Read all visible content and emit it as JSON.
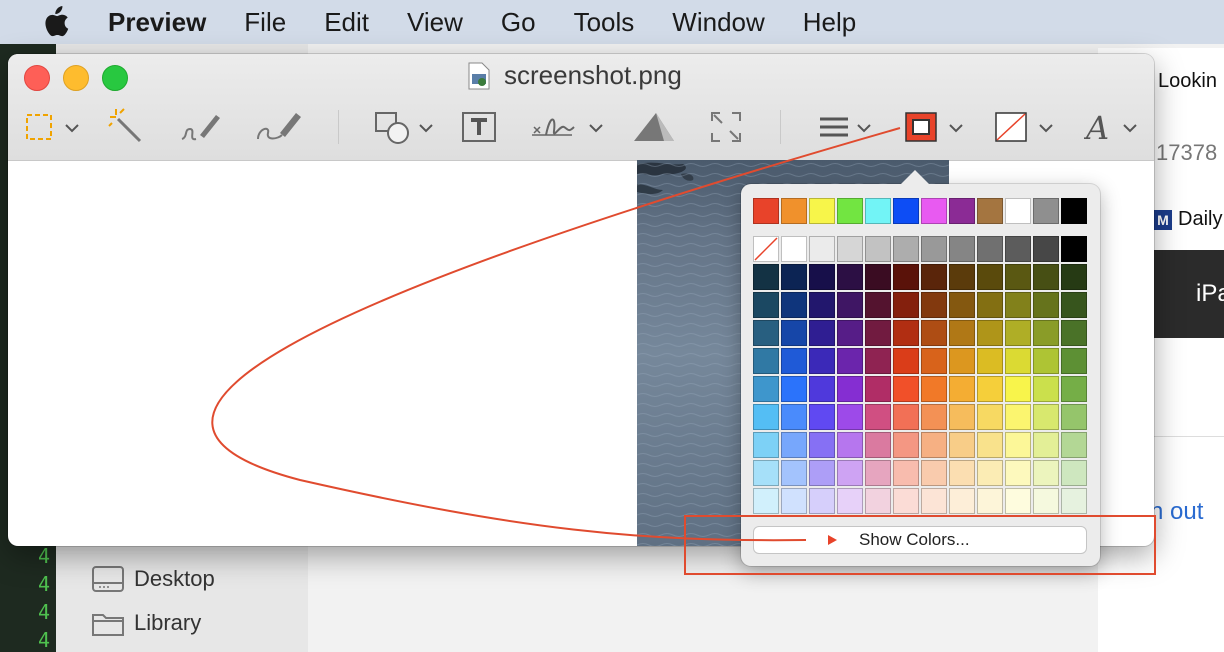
{
  "menubar": {
    "app_name": "Preview",
    "items": [
      "File",
      "Edit",
      "View",
      "Go",
      "Tools",
      "Window",
      "Help"
    ]
  },
  "window": {
    "title": "screenshot.png",
    "toolbar": {
      "icons": [
        "rectangular-selection-icon",
        "instant-alpha-icon",
        "sketch-icon",
        "draw-icon",
        "shapes-icon",
        "text-icon",
        "sign-icon",
        "adjust-color-icon",
        "adjust-size-icon",
        "shape-style-icon",
        "border-color-icon",
        "fill-color-icon",
        "text-style-icon"
      ]
    }
  },
  "background": {
    "finder_items": [
      "Desktop",
      "Library"
    ],
    "terminal_numbers": [
      "4",
      "4",
      "4",
      "4"
    ],
    "browser": {
      "title_snippet": "Lookin",
      "number_snippet": "17378",
      "news_snippet": "Daily",
      "news_logo": "M",
      "banner_snippet": "iPa",
      "link_snippet": "n out"
    }
  },
  "color_popover": {
    "show_colors_label": "Show Colors...",
    "top_row": [
      "#e8432a",
      "#f0912c",
      "#f7f54a",
      "#72e541",
      "#72f4f6",
      "#0d4df5",
      "#e85af1",
      "#8b2b95",
      "#a47540",
      "#ffffff",
      "#8f8f8f",
      "#000000"
    ],
    "gray_row": [
      "none",
      "#ffffff",
      "#ebebeb",
      "#d6d6d6",
      "#c2c2c2",
      "#adadad",
      "#999999",
      "#858585",
      "#707070",
      "#5c5c5c",
      "#474747",
      "#000000"
    ],
    "grid": [
      [
        "#133244",
        "#0c2454",
        "#170f4a",
        "#2c0f44",
        "#3a0c22",
        "#5a1209",
        "#5a250a",
        "#5b3b0b",
        "#5a4a0c",
        "#5a5812",
        "#474f14",
        "#263a14"
      ],
      [
        "#1b4862",
        "#0f357c",
        "#22176d",
        "#3f1664",
        "#54132f",
        "#84200d",
        "#82390e",
        "#845810",
        "#836f12",
        "#82811b",
        "#66731c",
        "#37551d"
      ],
      [
        "#285f80",
        "#1646a8",
        "#2f1e92",
        "#561d87",
        "#711b40",
        "#b12e12",
        "#ae4d14",
        "#b07816",
        "#af9519",
        "#afae26",
        "#8a9c28",
        "#4a7228"
      ],
      [
        "#3079a4",
        "#1f5ad7",
        "#3b29b8",
        "#6b25ac",
        "#8f2352",
        "#da3d19",
        "#d8631b",
        "#dc971f",
        "#dbbc23",
        "#dbda33",
        "#aec434",
        "#5d9034"
      ],
      [
        "#3e96cc",
        "#2b73fb",
        "#4f39dc",
        "#852ed2",
        "#b02d66",
        "#f15029",
        "#f17928",
        "#f4ad33",
        "#f5cf3a",
        "#f8f44b",
        "#cbe04c",
        "#75ae47"
      ],
      [
        "#54bef4",
        "#4a8bfc",
        "#6049f2",
        "#9d4ae9",
        "#d04f82",
        "#f27056",
        "#f39155",
        "#f6bc5c",
        "#f7d962",
        "#fbf56f",
        "#d8e86e",
        "#95c56b"
      ],
      [
        "#7dd1f6",
        "#77a7fc",
        "#8670f4",
        "#b676ee",
        "#da7aa0",
        "#f49783",
        "#f6b083",
        "#f8cd88",
        "#f9e28c",
        "#fcf798",
        "#e3ef97",
        "#b3d795"
      ],
      [
        "#a6e0f9",
        "#a3c3fd",
        "#ad9ef7",
        "#cea3f3",
        "#e6a5bf",
        "#f8bcae",
        "#f9cbad",
        "#fbdeb1",
        "#fbecb4",
        "#fdf9bd",
        "#ecf4bd",
        "#cee7bf"
      ],
      [
        "#d1f0fc",
        "#d0e1fe",
        "#d6cffb",
        "#e7d1f9",
        "#f2d2df",
        "#fbdcd6",
        "#fce4d6",
        "#fdeed8",
        "#fdf5d9",
        "#fefcde",
        "#f5f9de",
        "#e6f2df"
      ]
    ]
  }
}
